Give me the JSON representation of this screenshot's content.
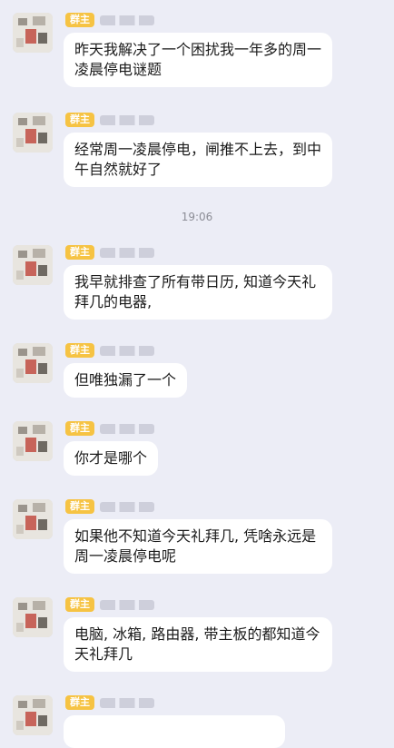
{
  "group_badge": "群主",
  "timestamp": "19:06",
  "messages": [
    {
      "text": "昨天我解决了一个困扰我一年多的周一凌晨停电谜题"
    },
    {
      "text": "经常周一凌晨停电，闸推不上去，到中午自然就好了"
    },
    {
      "text": "我早就排查了所有带日历, 知道今天礼拜几的电器,"
    },
    {
      "text": "但唯独漏了一个"
    },
    {
      "text": "你才是哪个"
    },
    {
      "text": "如果他不知道今天礼拜几, 凭啥永远是周一凌晨停电呢"
    },
    {
      "text": "电脑, 冰箱, 路由器, 带主板的都知道今天礼拜几"
    },
    {
      "text": ""
    }
  ],
  "colors": {
    "badge": "#f6c343",
    "background": "#ecedf6",
    "bubble": "#ffffff"
  }
}
